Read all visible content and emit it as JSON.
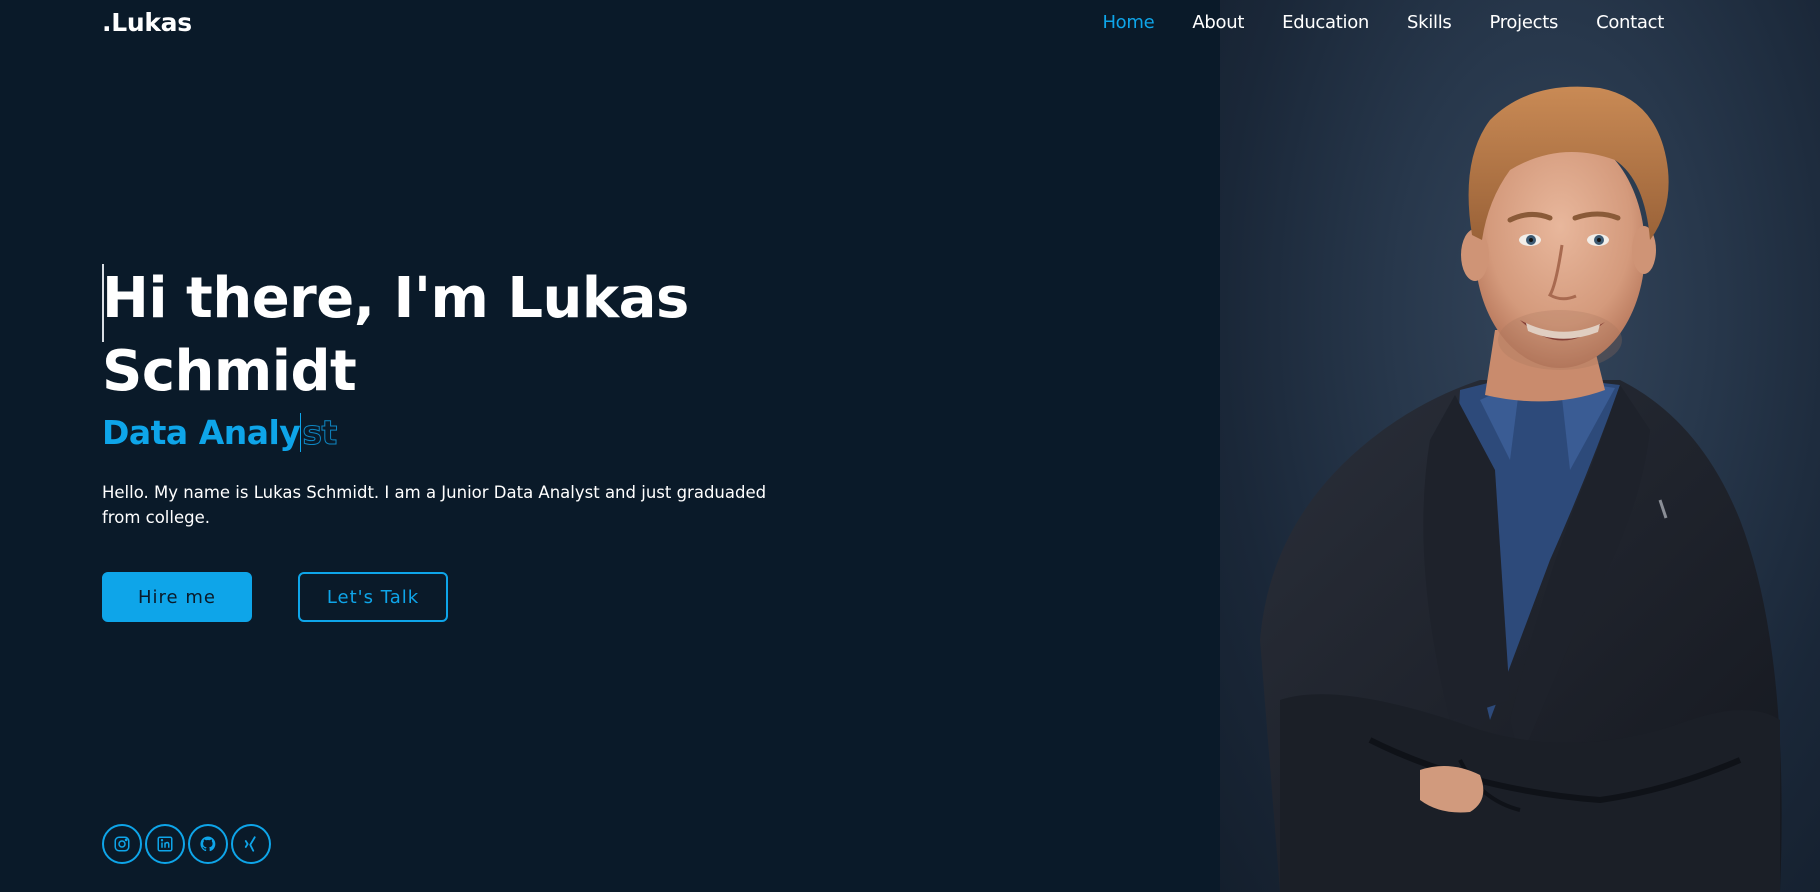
{
  "header": {
    "logo": ".Lukas",
    "nav": [
      {
        "label": "Home",
        "active": true
      },
      {
        "label": "About",
        "active": false
      },
      {
        "label": "Education",
        "active": false
      },
      {
        "label": "Skills",
        "active": false
      },
      {
        "label": "Projects",
        "active": false
      },
      {
        "label": "Contact",
        "active": false
      }
    ]
  },
  "hero": {
    "title": "Hi there, I'm Lukas Schmidt",
    "subtitle_typed": "Data Analy",
    "subtitle_pending": "st",
    "description": "Hello. My name is Lukas Schmidt. I am a Junior Data Analyst and just graduaded from college.",
    "primary_button": "Hire me",
    "secondary_button": "Let's Talk"
  },
  "socials": [
    {
      "icon": "instagram-icon"
    },
    {
      "icon": "linkedin-icon"
    },
    {
      "icon": "github-icon"
    },
    {
      "icon": "xing-icon"
    }
  ],
  "colors": {
    "background": "#0a1a29",
    "accent": "#0ea5e9",
    "text": "#ffffff"
  }
}
